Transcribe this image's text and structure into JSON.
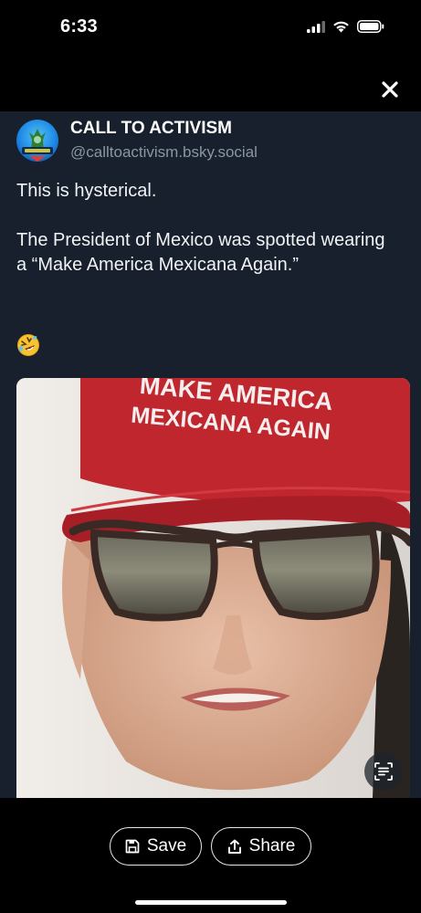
{
  "status_bar": {
    "time": "6:33"
  },
  "post": {
    "author_name": "CALL TO ACTIVISM",
    "author_handle": "@calltoactivism.bsky.social",
    "paragraphs": [
      "This is hysterical.",
      "The President of Mexico was spotted wearing a “Make America Mexicana Again.”"
    ],
    "emoji": "rolling-on-floor-laughing",
    "image": {
      "cap_line1": "MAKE AMERICA",
      "cap_line2": "MEXICANA AGAIN"
    }
  },
  "actions": {
    "save_label": "Save",
    "share_label": "Share"
  },
  "colors": {
    "sheet_bg": "#17202c",
    "handle": "#8a96a6",
    "cap_red": "#c0262d"
  }
}
